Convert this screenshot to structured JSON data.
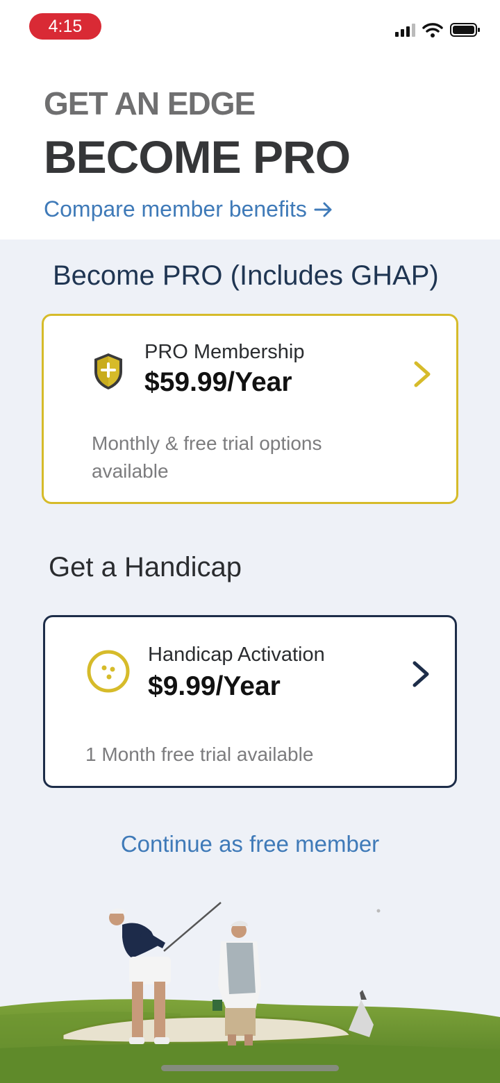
{
  "status_bar": {
    "time": "4:15",
    "signal_icon": "cellular-signal-icon",
    "wifi_icon": "wifi-icon",
    "battery_icon": "battery-icon"
  },
  "header": {
    "kicker": "GET AN EDGE",
    "headline": "BECOME PRO",
    "compare_link": "Compare member benefits",
    "compare_icon": "arrow-right-icon"
  },
  "pro_section": {
    "title": "Become PRO (Includes GHAP)",
    "card": {
      "icon": "shield-plus-icon",
      "name": "PRO Membership",
      "price": "$59.99/Year",
      "note": "Monthly & free trial options available",
      "border_color": "#d6bb2a"
    }
  },
  "handicap_section": {
    "title": "Get a Handicap",
    "card": {
      "icon": "golf-ball-icon",
      "name": "Handicap Activation",
      "price": "$9.99/Year",
      "note": "1 Month free trial available",
      "border_color": "#1d2d49"
    }
  },
  "continue_link": "Continue as free member",
  "colors": {
    "gold": "#d6bb2a",
    "navy": "#1d2d49",
    "link_blue": "#3f7ab8",
    "status_red": "#d92a35"
  }
}
